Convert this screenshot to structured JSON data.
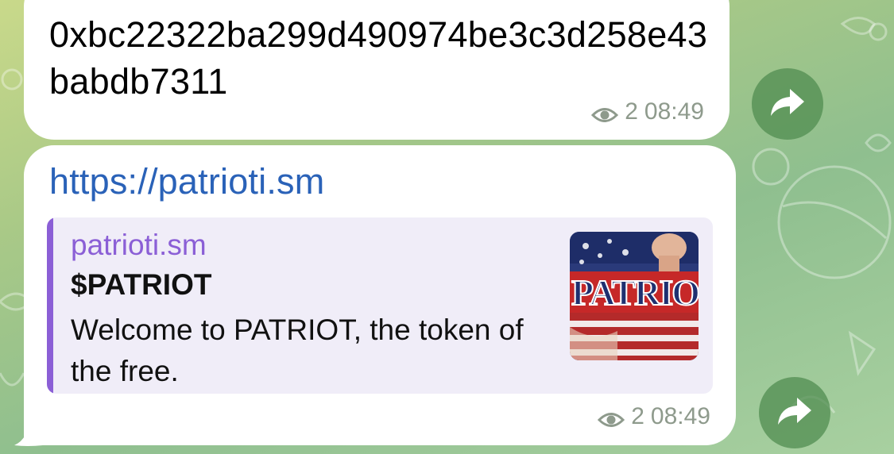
{
  "messages": [
    {
      "text": "0xbc22322ba299d490974be3c3d258e43babdb7311",
      "views": "2",
      "time": "08:49"
    },
    {
      "link": "https://patrioti.sm",
      "preview": {
        "site": "patrioti.sm",
        "title": "$PATRIOT",
        "description": "Welcome to PATRIOT, the token of the free.",
        "thumbnail_text": "PATRIO"
      },
      "views": "2",
      "time": "08:49"
    }
  ],
  "colors": {
    "link": "#2a62b8",
    "preview_accent": "#8b5fd6",
    "meta": "#8e9a8c",
    "share_button": "#508c50"
  },
  "icons": {
    "views": "eye-icon",
    "share": "share-arrow-icon"
  }
}
